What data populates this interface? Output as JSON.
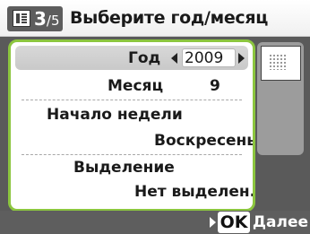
{
  "header": {
    "step_current": "3",
    "step_total": "/5",
    "title": "Выберите год/месяц",
    "icon": "calendar-layout-icon"
  },
  "settings": {
    "year": {
      "label": "Год",
      "value": "2009"
    },
    "month": {
      "label": "Месяц",
      "value": "9"
    },
    "week_start": {
      "label": "Начало недели",
      "value": "Воскресенье"
    },
    "highlight": {
      "label": "Выделение",
      "value": "Нет выделен."
    }
  },
  "preview": {
    "icon": "calendar-thumbnail-icon"
  },
  "footer": {
    "ok_label": "OK",
    "next_label": "Далее"
  },
  "colors": {
    "accent": "#8cc63f",
    "selected_row": "#d0d0d0",
    "background": "#5a5a5a"
  }
}
